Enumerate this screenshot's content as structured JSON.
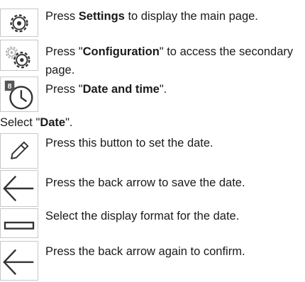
{
  "steps": [
    {
      "icon": "settings-gear-icon",
      "pre": "Press ",
      "bold": "Settings",
      "post": " to display the main page."
    },
    {
      "icon": "configuration-gears-icon",
      "pre": "Press \"",
      "bold": "Configuration",
      "post": "\" to access the secondary page."
    },
    {
      "icon": "date-and-time-clock-icon",
      "pre": "Press \"",
      "bold": "Date and time",
      "post": "\"."
    },
    {
      "pre": "Select \"",
      "bold": "Date",
      "post": "\"."
    },
    {
      "icon": "edit-pencil-icon",
      "text": "Press this button to set the date."
    },
    {
      "icon": "back-arrow-icon",
      "text": "Press the back arrow to save the date."
    },
    {
      "icon": "display-format-icon",
      "text": "Select the display format for the date."
    },
    {
      "icon": "back-arrow-icon",
      "text": "Press the back arrow again to confirm."
    }
  ],
  "clock_badge": "8"
}
